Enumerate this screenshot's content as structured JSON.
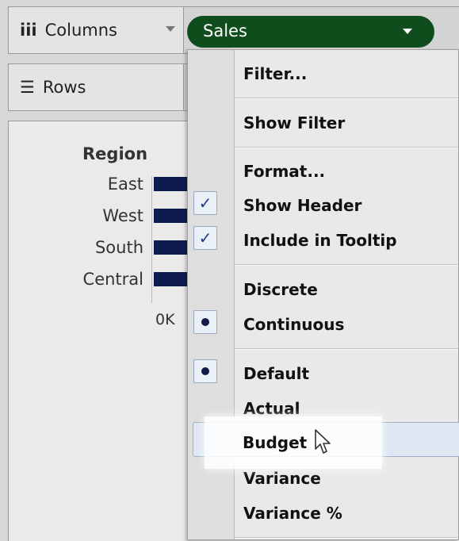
{
  "shelves": {
    "columns": {
      "icon": "iii",
      "icon_name": "columns-icon",
      "label": "Columns"
    },
    "rows": {
      "icon": "☰",
      "icon_name": "rows-icon",
      "label": "Rows"
    }
  },
  "pill": {
    "label": "Sales",
    "color": "#0f4d1c"
  },
  "view": {
    "region_header": "Region",
    "regions": [
      "East",
      "West",
      "South",
      "Central"
    ],
    "axis_zero": "0K",
    "bar_color": "#0d1b4f"
  },
  "menu": {
    "items": [
      {
        "label": "Filter..."
      },
      {
        "label": "Show Filter"
      },
      {
        "label": "Format..."
      },
      {
        "label": "Show Header",
        "mark": "check"
      },
      {
        "label": "Include in Tooltip",
        "mark": "check"
      },
      {
        "label": "Discrete"
      },
      {
        "label": "Continuous",
        "mark": "dot"
      },
      {
        "label": "Default",
        "mark": "dot"
      },
      {
        "label": "Actual"
      },
      {
        "label": "Budget"
      },
      {
        "label": "Variance"
      },
      {
        "label": "Variance %"
      }
    ],
    "hovered": "Budget"
  }
}
